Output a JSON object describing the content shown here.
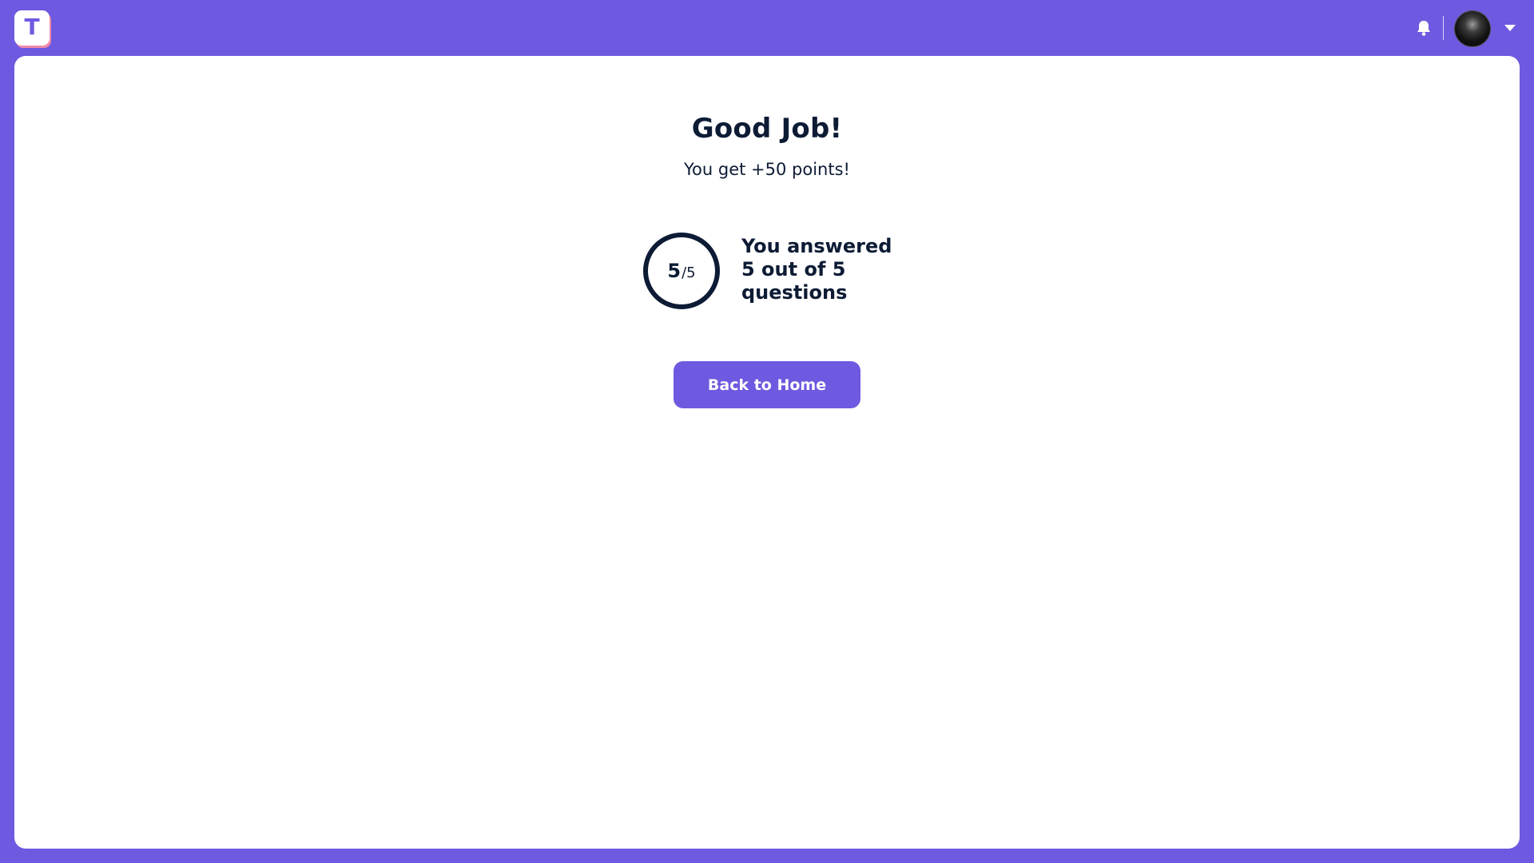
{
  "app": {
    "logo_letter": "T",
    "notification_icon": "bell-icon",
    "profile_menu_icon": "chevron-down-icon"
  },
  "result": {
    "title": "Good Job!",
    "points_message": "You get +50 points!",
    "score_correct": "5",
    "score_total": "/5",
    "correct_count": 5,
    "total_count": 5,
    "answered_text": "You answered 5 out of 5 questions"
  },
  "actions": {
    "back_home_label": "Back to Home"
  },
  "colors": {
    "brand": "#6e5ae0",
    "text": "#0d1b35",
    "card": "#ffffff"
  }
}
